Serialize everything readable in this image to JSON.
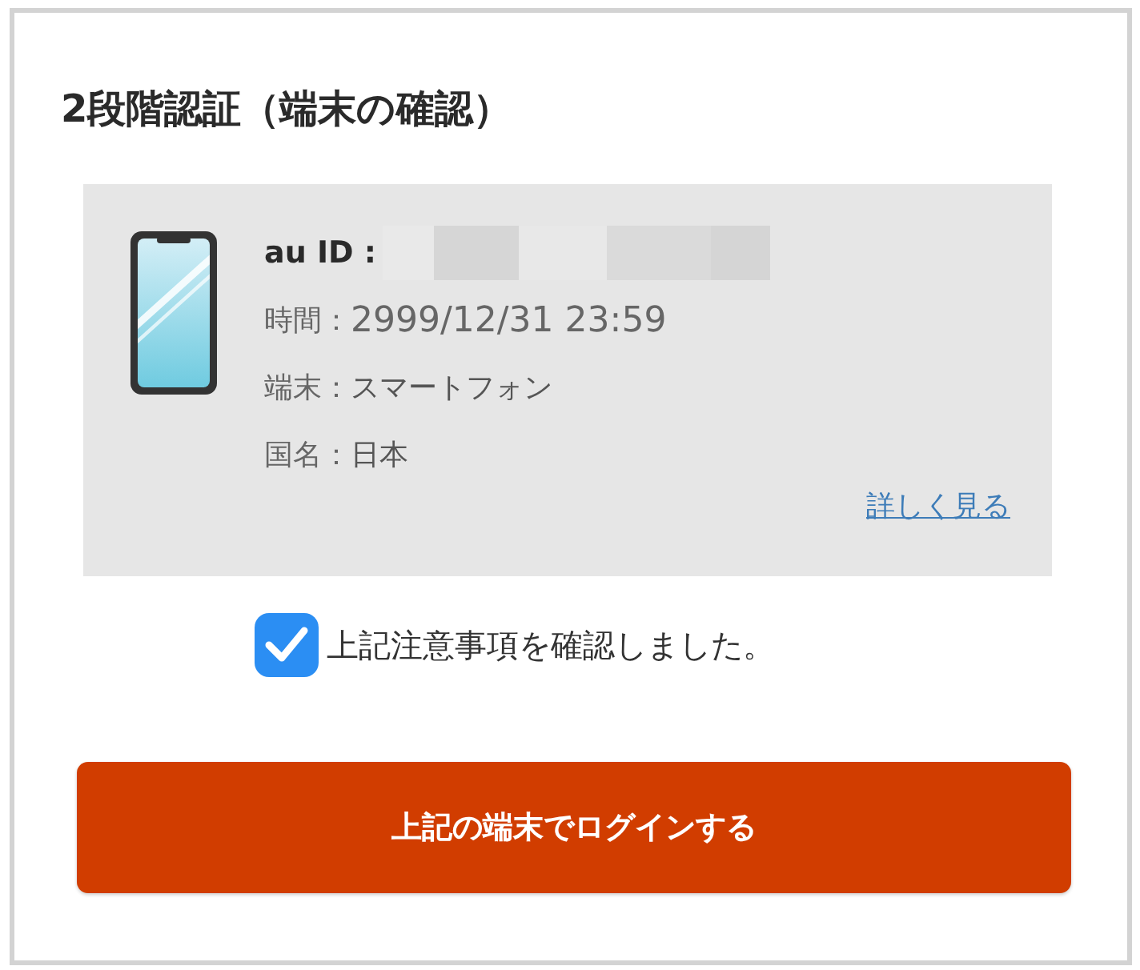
{
  "title": "2段階認証（端末の確認）",
  "device_card": {
    "id_label": "au ID :",
    "details": [
      {
        "label": "時間：",
        "value": "2999/12/31 23:59",
        "kind": "latin"
      },
      {
        "label": "端末：",
        "value": "スマートフォン",
        "kind": "text"
      },
      {
        "label": "国名：",
        "value": "日本",
        "kind": "text"
      }
    ],
    "link": "詳しく見る"
  },
  "confirmation": {
    "label": "上記注意事項を確認しました。",
    "checked": true
  },
  "login_button": {
    "label": "上記の端末でログインする"
  }
}
